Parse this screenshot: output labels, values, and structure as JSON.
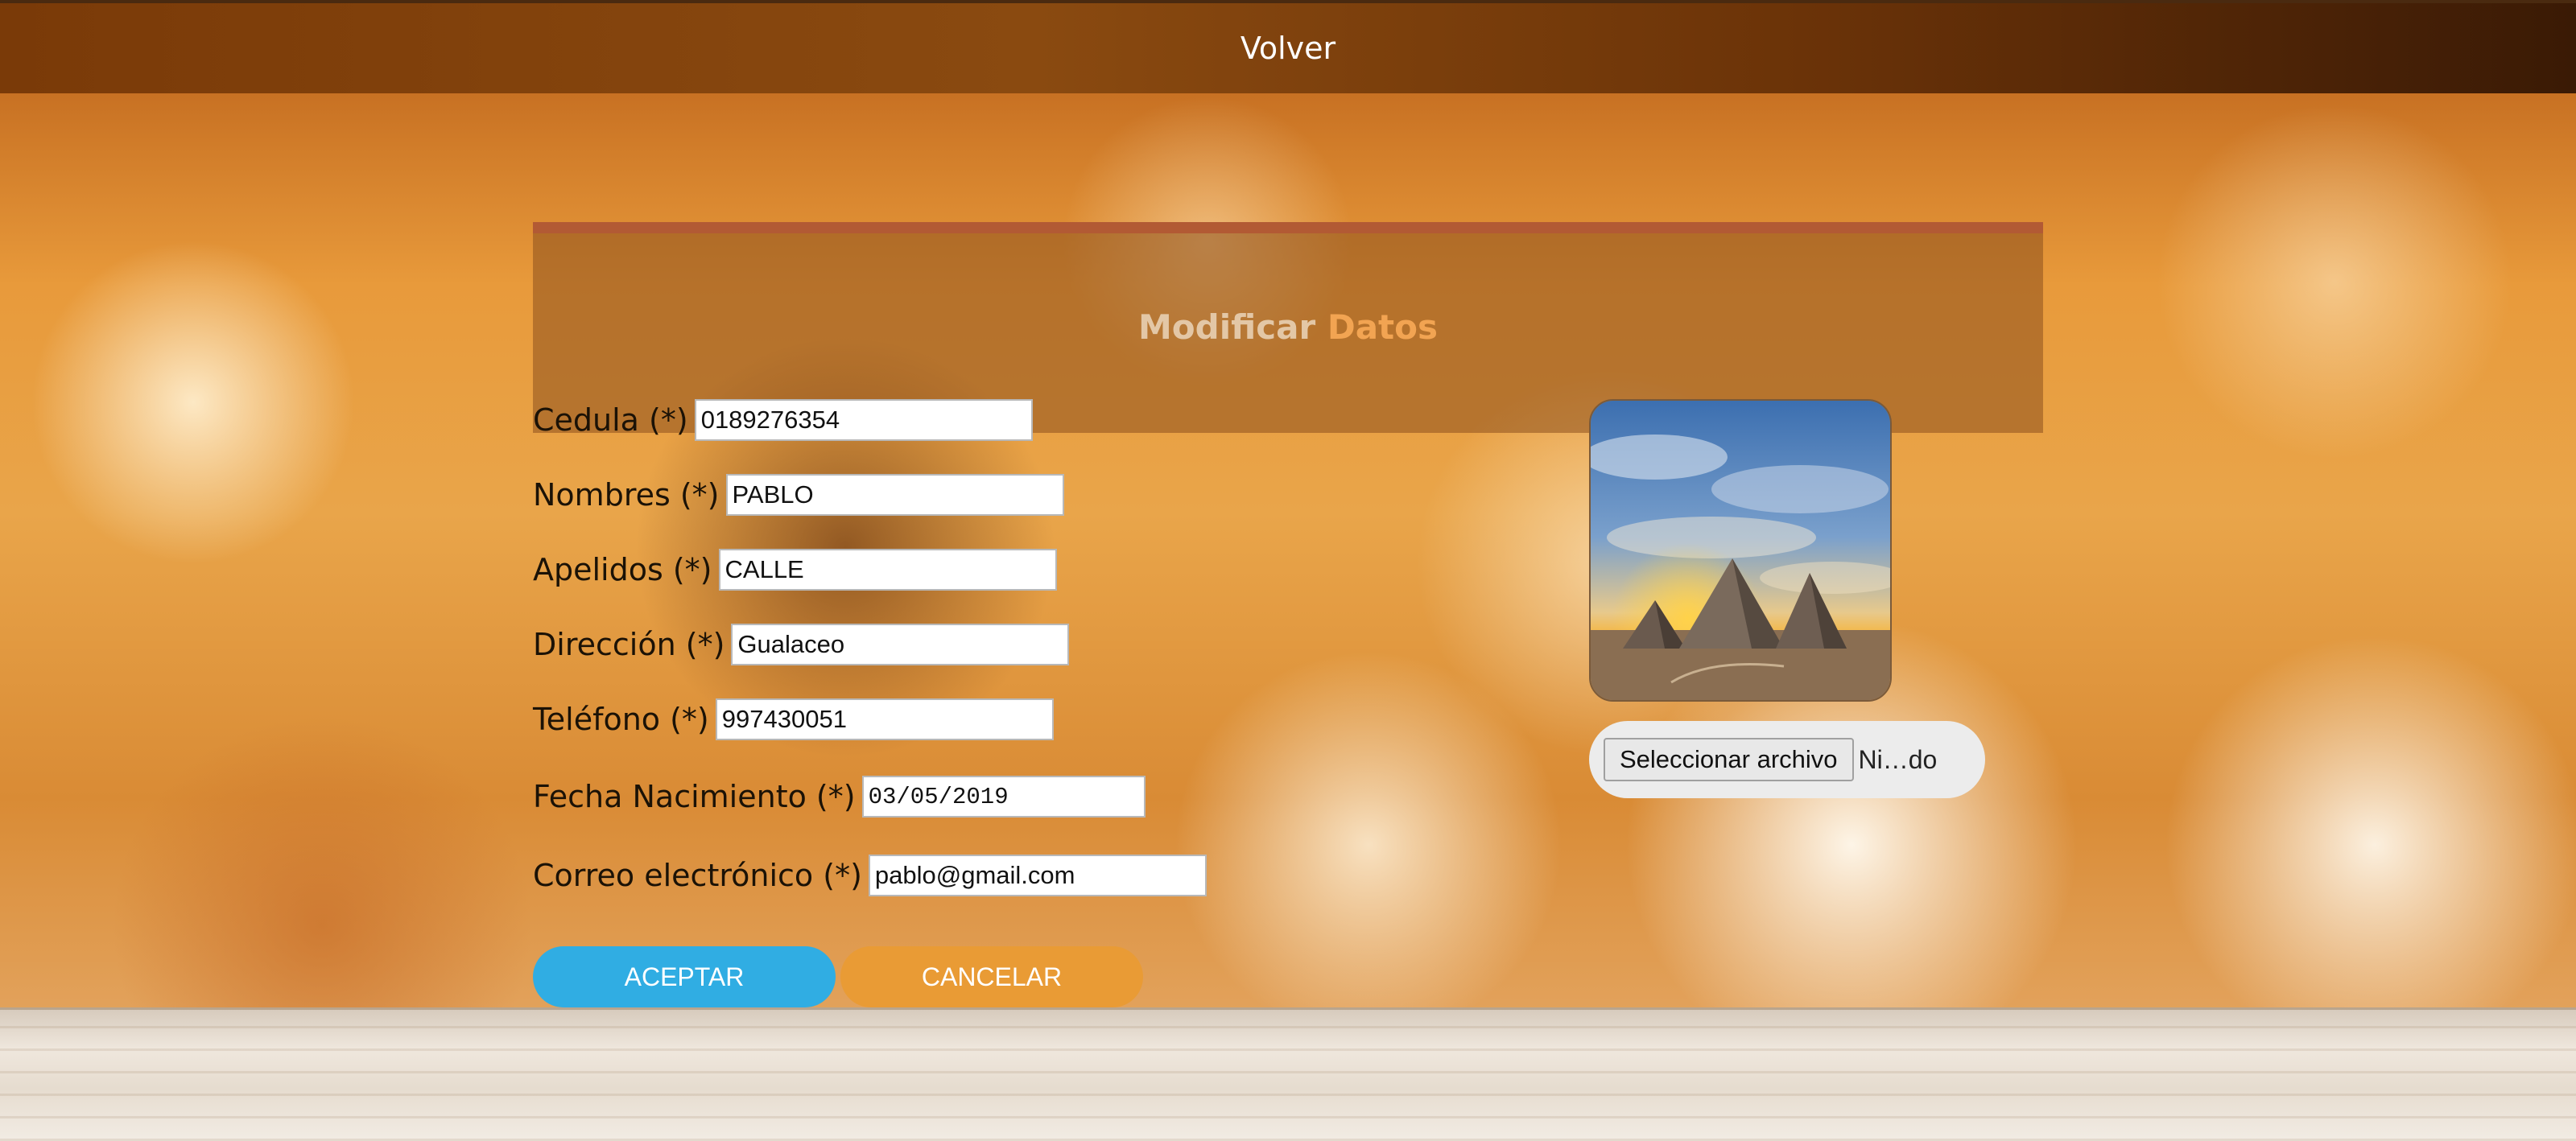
{
  "nav": {
    "back_label": "Volver"
  },
  "form": {
    "title_part1": "Modificar",
    "title_part2": "Datos",
    "fields": [
      {
        "label": "Cedula (*)",
        "value": "0189276354"
      },
      {
        "label": "Nombres (*)",
        "value": "PABLO"
      },
      {
        "label": "Apelidos (*)",
        "value": "CALLE"
      },
      {
        "label": "Dirección (*)",
        "value": "Gualaceo"
      },
      {
        "label": "Teléfono (*)",
        "value": "997430051"
      },
      {
        "label": "Fecha Nacimiento (*)",
        "value": "03/05/2019"
      },
      {
        "label": "Correo electrónico (*)",
        "value": "pablo@gmail.com"
      }
    ],
    "accept_label": "ACEPTAR",
    "cancel_label": "CANCELAR"
  },
  "photo": {
    "file_button_label": "Seleccionar archivo",
    "file_name": "Ni…do"
  },
  "colors": {
    "accept": "#30ade3",
    "cancel": "#e99b35",
    "title_accent": "#f2a452"
  }
}
